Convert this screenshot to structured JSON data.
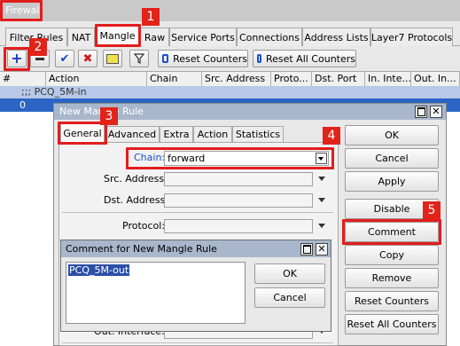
{
  "window": {
    "title": "Firewall"
  },
  "tabs": [
    "Filter Rules",
    "NAT",
    "Mangle",
    "Raw",
    "Service Ports",
    "Connections",
    "Address Lists",
    "Layer7 Protocols"
  ],
  "toolbar": {
    "reset_counters": "Reset Counters",
    "reset_all_counters": "Reset All Counters"
  },
  "table": {
    "columns": [
      "#",
      "Action",
      "Chain",
      "Src. Address",
      "Proto...",
      "Dst. Port",
      "In. Inte...",
      "Out. In..."
    ],
    "comment_row": ";;; PCQ_5M-in",
    "row_index": "0"
  },
  "dialog": {
    "title": "New Mangle Rule",
    "tabs": [
      "General",
      "Advanced",
      "Extra",
      "Action",
      "Statistics"
    ],
    "fields": {
      "chain_label": "Chain:",
      "chain_value": "forward",
      "src_address_label": "Src. Address:",
      "dst_address_label": "Dst. Address:",
      "protocol_label": "Protocol:",
      "out_interface_label": "Out. Interface:"
    },
    "buttons": [
      "OK",
      "Cancel",
      "Apply",
      "Disable",
      "Comment",
      "Copy",
      "Remove",
      "Reset Counters",
      "Reset All Counters"
    ]
  },
  "comment_dialog": {
    "title": "Comment for New Mangle Rule",
    "text": "PCQ_5M-out",
    "ok": "OK",
    "cancel": "Cancel"
  },
  "annotations": [
    "1",
    "2",
    "3",
    "4",
    "5"
  ],
  "colors": {
    "annotation": "#e2231a",
    "title_bar": "#a9b7cc",
    "selection": "#1f4fa8"
  }
}
